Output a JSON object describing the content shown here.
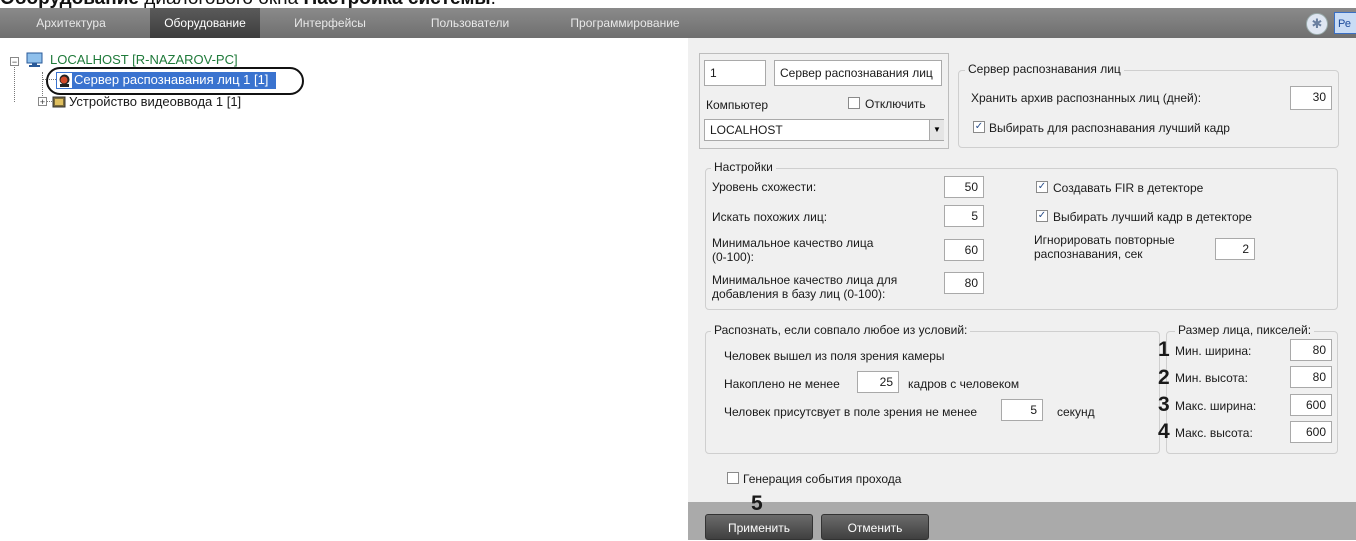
{
  "doc_caption": {
    "bold1": "Оборудование",
    "text": " диалогового окна ",
    "bold2": "Настройка системы",
    "end": "."
  },
  "tabs": [
    "Архитектура",
    "Оборудование",
    "Интерфейсы",
    "Пользователи",
    "Программирование"
  ],
  "tab_right_label": "Ре",
  "tree": {
    "root": "LOCALHOST [R-NAZAROV-PC]",
    "selected": "Сервер распознавания лиц 1 [1]",
    "sibling": "Устройство видеоввода 1 [1]"
  },
  "header": {
    "id_value": "1",
    "name_value": "Сервер распознавания лиц",
    "computer_label": "Компьютер",
    "disable_label": "Отключить",
    "computer_value": "LOCALHOST"
  },
  "server_group": {
    "title": "Сервер распознавания лиц",
    "archive_label": "Хранить архив распознанных лиц (дней):",
    "archive_value": "30",
    "best_frame_label": "Выбирать для распознавания лучший кадр"
  },
  "settings": {
    "title": "Настройки",
    "similarity_label": "Уровень схожести:",
    "similarity_value": "50",
    "similar_label": "Искать похожих лиц:",
    "similar_value": "5",
    "min_quality_label1": "Минимальное качество лица",
    "min_quality_label2": "(0-100):",
    "min_quality_value": "60",
    "min_quality_db_label1": "Минимальное качество лица для",
    "min_quality_db_label2": "добавления в базу лиц (0-100):",
    "min_quality_db_value": "80",
    "create_fir_label": "Создавать FIR в детекторе",
    "best_frame_detector_label": "Выбирать лучший кадр в детекторе",
    "ignore_label1": "Игнорировать повторные",
    "ignore_label2": "распознавания, сек",
    "ignore_value": "2"
  },
  "recognize": {
    "title": "Распознать, если совпало любое из условий:",
    "left_view_label": "Человек вышел из поля зрения камеры",
    "accum_prefix": "Накоплено не менее",
    "accum_value": "25",
    "accum_suffix": "кадров с человеком",
    "present_prefix": "Человек присутсвует в поле зрения не менее",
    "present_value": "5",
    "present_suffix": "секунд"
  },
  "face_size": {
    "title": "Размер лица, пикселей:",
    "min_width_label": "Мин. ширина:",
    "min_width_value": "80",
    "min_height_label": "Мин. высота:",
    "min_height_value": "80",
    "max_width_label": "Макс. ширина:",
    "max_width_value": "600",
    "max_height_label": "Макс. высота:",
    "max_height_value": "600"
  },
  "callouts": [
    "1",
    "2",
    "3",
    "4",
    "5"
  ],
  "pass_event_label": "Генерация события прохода",
  "buttons": {
    "apply": "Применить",
    "cancel": "Отменить"
  }
}
